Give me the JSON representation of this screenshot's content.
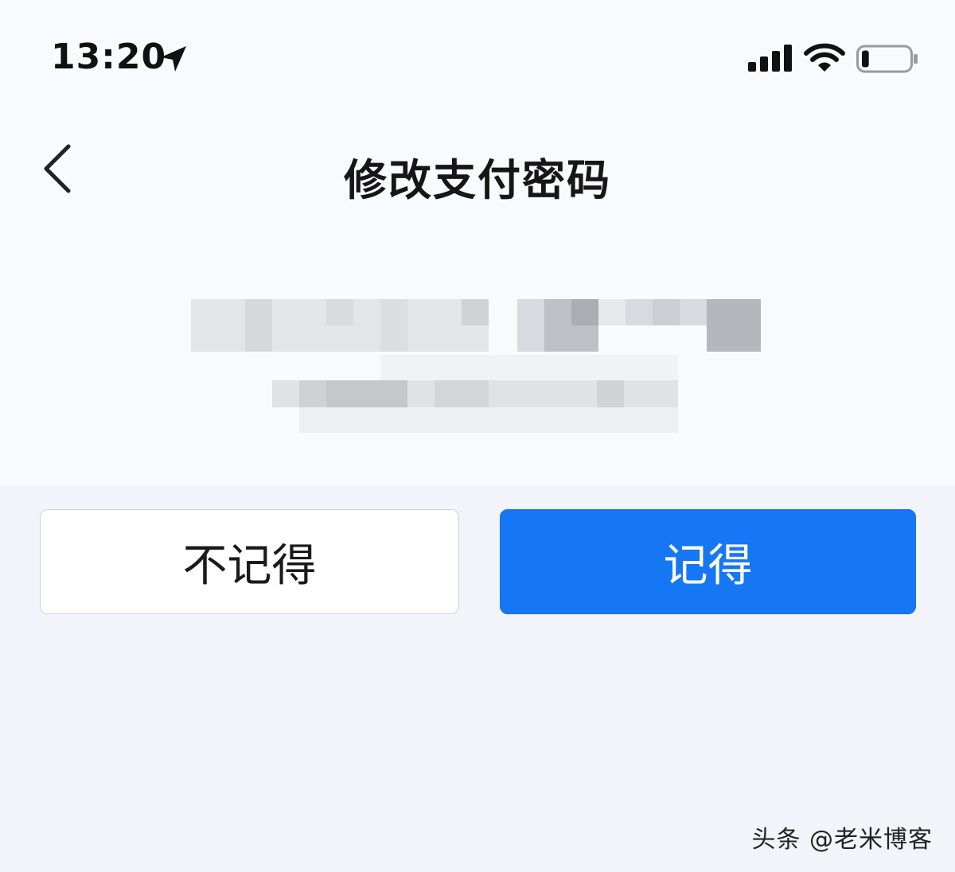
{
  "status_bar": {
    "time": "13:20",
    "icons": [
      "location-arrow-icon",
      "signal-bars-icon",
      "wifi-icon",
      "battery-icon"
    ],
    "battery_level": 0.15
  },
  "nav": {
    "back_icon": "chevron-left-icon",
    "title": "修改支付密码"
  },
  "buttons": {
    "dont_remember": "不记得",
    "remember": "记得"
  },
  "colors": {
    "primary": "#1677f5",
    "page_background": "#f2f4f9",
    "header_background": "#f9fafd"
  },
  "watermark": "头条 @老米博客"
}
